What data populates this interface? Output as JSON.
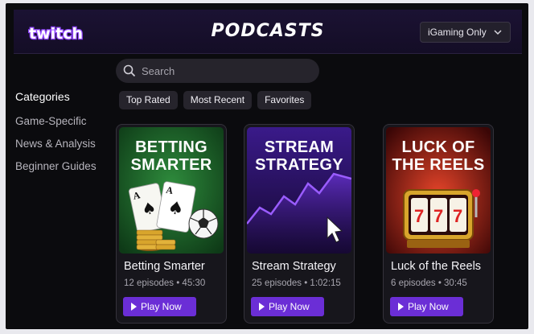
{
  "header": {
    "logo_text": "twitch",
    "title": "PODCASTS",
    "filter": {
      "selected": "iGaming Only",
      "icon": "chevron-down-icon"
    }
  },
  "search": {
    "placeholder": "Search",
    "value": "",
    "icon": "search-icon"
  },
  "tabs": [
    {
      "label": "Top Rated"
    },
    {
      "label": "Most Recent"
    },
    {
      "label": "Favorites"
    }
  ],
  "sidebar": {
    "heading": "Categories",
    "items": [
      {
        "label": "Game-Specific"
      },
      {
        "label": "News & Analysis"
      },
      {
        "label": "Beginner Guides"
      }
    ]
  },
  "podcasts": [
    {
      "art_title_line1": "BETTING",
      "art_title_line2": "SMARTER",
      "name": "Betting Smarter",
      "meta": "12 episodes • 45:30",
      "play_label": "Play Now",
      "art_colors": [
        "#2e8b3c",
        "#0e3a17"
      ]
    },
    {
      "art_title_line1": "STREAM",
      "art_title_line2": "STRATEGY",
      "name": "Stream Strategy",
      "meta": "25 episodes • 1:02:15",
      "play_label": "Play Now",
      "art_colors": [
        "#3a1a8a",
        "#14082e"
      ]
    },
    {
      "art_title_line1": "LUCK OF",
      "art_title_line2": "THE REELS",
      "name": "Luck of the Reels",
      "meta": "6 episodes • 30:45",
      "play_label": "Play Now",
      "art_colors": [
        "#c7281a",
        "#3a0606"
      ]
    }
  ],
  "colors": {
    "accent": "#6b2ed6",
    "background": "#0b0b0e",
    "header": "#1b1233"
  }
}
